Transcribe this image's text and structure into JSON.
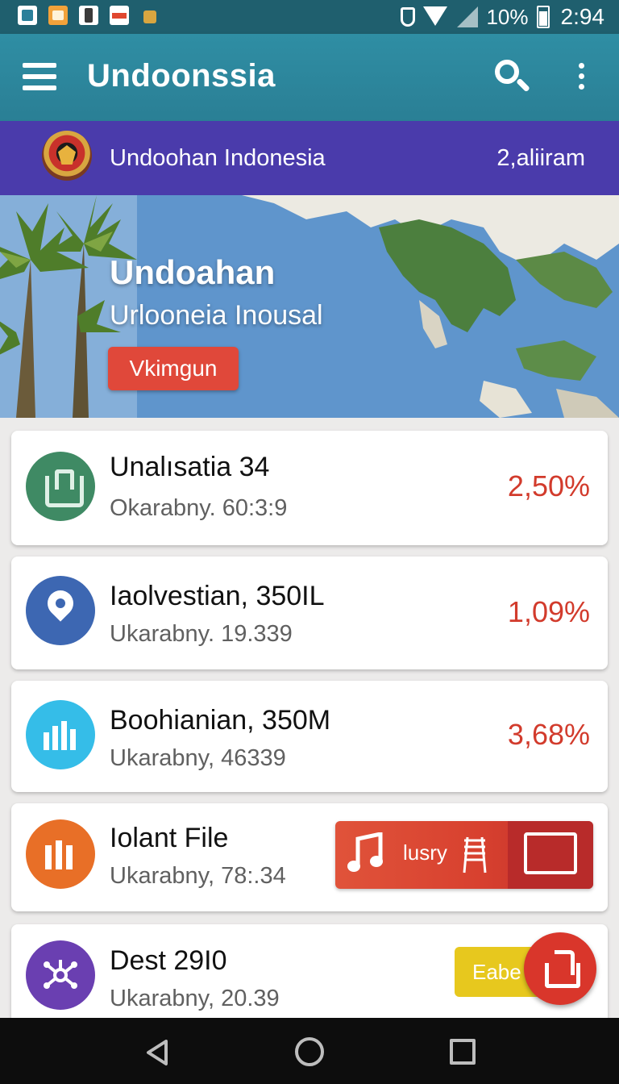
{
  "status_bar": {
    "battery": "10%",
    "time": "2:94"
  },
  "app_bar": {
    "title": "Undoonssia"
  },
  "sub_header": {
    "title": "Undoohan Indonesia",
    "right_text": "2,aliiram"
  },
  "hero": {
    "title": "Undoahan",
    "subtitle": "Urlooneia Inousal",
    "button_label": "Vkimgun"
  },
  "cards": [
    {
      "title": "Unalısatia 34",
      "subtitle": "Okarabny. 60:3:9",
      "value": "2,50%",
      "icon": "trash-icon",
      "icon_color": "#3f8a64"
    },
    {
      "title": "Iaolvestian, 350IL",
      "subtitle": "Ukarabny. 19.339",
      "value": "1,09%",
      "icon": "location-pin-icon",
      "icon_color": "#3d67b2"
    },
    {
      "title": "Boohianian, 350M",
      "subtitle": "Ukarabny, 46339",
      "value": "3,68%",
      "icon": "bar-chart-icon",
      "icon_color": "#35bde8"
    },
    {
      "title": "Iolant File",
      "subtitle": "Ukarabny, 78:.34",
      "icon": "columns-icon",
      "icon_color": "#e86f27"
    },
    {
      "title": "Dest 29I0",
      "subtitle": "Ukarabny, 20.39",
      "icon": "hub-icon",
      "icon_color": "#6a3fb1"
    }
  ],
  "media_strip": {
    "label": "lusry"
  },
  "yellow_chip": {
    "label": "Eabe"
  },
  "colors": {
    "status_bar": "#1f5f6e",
    "app_bar": "#2f8ea4",
    "sub_header": "#4a3bab",
    "accent_red": "#d23b2c"
  }
}
